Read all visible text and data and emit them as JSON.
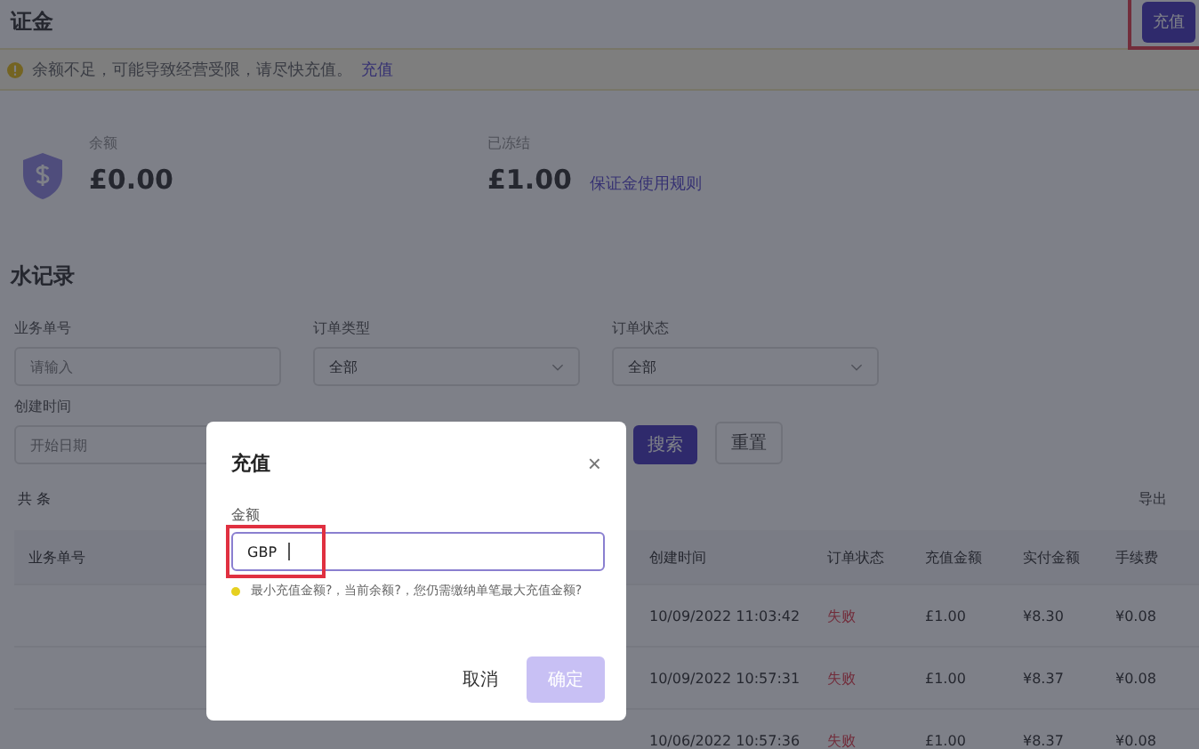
{
  "page": {
    "title": "证金",
    "top_button": "充值"
  },
  "alert": {
    "message": "余额不足，可能导致经营受限，请尽快充值。",
    "link": "充值"
  },
  "balances": [
    {
      "label": "余额",
      "amount": "£0.00"
    },
    {
      "label": "已冻结",
      "amount": "£1.00",
      "link": "保证金使用规则"
    }
  ],
  "records": {
    "title": "水记录",
    "filters": [
      {
        "kind": "input",
        "label": "业务单号",
        "placeholder": "请输入"
      },
      {
        "kind": "select",
        "label": "订单类型",
        "value": "全部"
      },
      {
        "kind": "select",
        "label": "订单状态",
        "value": "全部"
      },
      {
        "kind": "input",
        "label": "创建时间",
        "placeholder": "开始日期"
      }
    ],
    "buttons": [
      {
        "label": "搜索",
        "primary": true
      },
      {
        "label": "重置",
        "primary": false
      }
    ],
    "count": "共 条",
    "export": "导出",
    "columns": [
      "业务单号",
      "创建时间",
      "订单状态",
      "充值金额",
      "实付金额",
      "手续费"
    ],
    "rows": [
      [
        "",
        "10/09/2022 11:03:42",
        "失败",
        "£1.00",
        "¥8.30",
        "¥0.08"
      ],
      [
        "",
        "10/09/2022 10:57:31",
        "失败",
        "£1.00",
        "¥8.37",
        "¥0.08"
      ],
      [
        "",
        "10/06/2022 10:57:36",
        "失败",
        "£1.00",
        "¥8.37",
        "¥0.08"
      ]
    ]
  },
  "dialog": {
    "title": "充值",
    "close": "×",
    "field_label": "金额",
    "prefix": "GBP",
    "hint": "最小充值金额?，当前余额?，您仍需缴纳单笔最大充值金额?",
    "buttons": [
      {
        "label": "取消",
        "primary": false
      },
      {
        "label": "确定",
        "primary": true
      }
    ]
  }
}
